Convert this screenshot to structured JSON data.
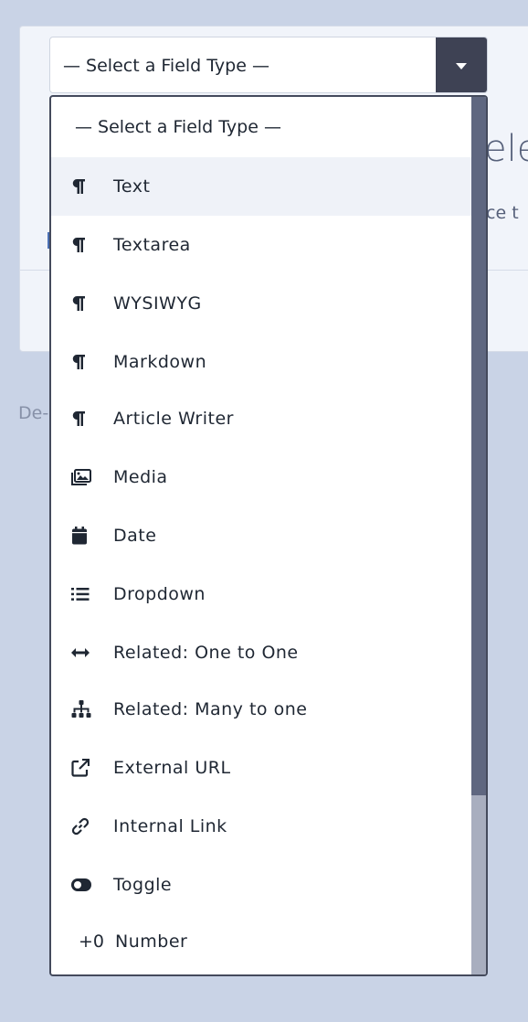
{
  "background": {
    "heading_fragment": "ele",
    "subtext_fragment": "nce t",
    "deleted_fragment": "De-"
  },
  "select": {
    "value": "— Select a Field Type —",
    "caret_icon": "caret-down-icon"
  },
  "dropdown": {
    "header": "— Select a Field Type —",
    "options": [
      {
        "label": "Text",
        "icon": "paragraph-icon"
      },
      {
        "label": "Textarea",
        "icon": "paragraph-icon"
      },
      {
        "label": "WYSIWYG",
        "icon": "paragraph-icon"
      },
      {
        "label": "Markdown",
        "icon": "paragraph-icon"
      },
      {
        "label": "Article Writer",
        "icon": "paragraph-icon"
      },
      {
        "label": "Media",
        "icon": "images-icon"
      },
      {
        "label": "Date",
        "icon": "calendar-icon"
      },
      {
        "label": "Dropdown",
        "icon": "list-icon"
      },
      {
        "label": "Related: One to One",
        "icon": "arrows-horizontal-icon"
      },
      {
        "label": "Related: Many to one",
        "icon": "sitemap-icon"
      },
      {
        "label": "External URL",
        "icon": "external-link-icon"
      },
      {
        "label": "Internal Link",
        "icon": "link-icon"
      },
      {
        "label": "Toggle",
        "icon": "toggle-icon"
      },
      {
        "label": "Number",
        "icon": "number-icon",
        "icon_text": "+0"
      }
    ],
    "hovered_index": 0
  },
  "colors": {
    "page_bg": "#c9d3e6",
    "caret_button_bg": "#3e4254",
    "hover_row_bg": "#eff2f8",
    "scroll_thumb": "#5f6780",
    "scroll_track": "#a8aebf"
  }
}
